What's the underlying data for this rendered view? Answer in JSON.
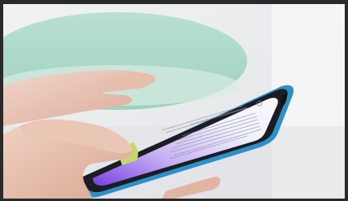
{
  "photo": {
    "subject": "hands-holding-smartphone",
    "screen": {
      "document_title": ""
    }
  },
  "colors": {
    "background_top": "#eef0f1",
    "table_green": "#a8d8c6",
    "phone_frame": "#2f8fc8",
    "phone_body": "#1b1d22",
    "screen_paper": "#f4f5fb",
    "screen_purple": "#a27adf",
    "skin": "#e8c1ad"
  }
}
